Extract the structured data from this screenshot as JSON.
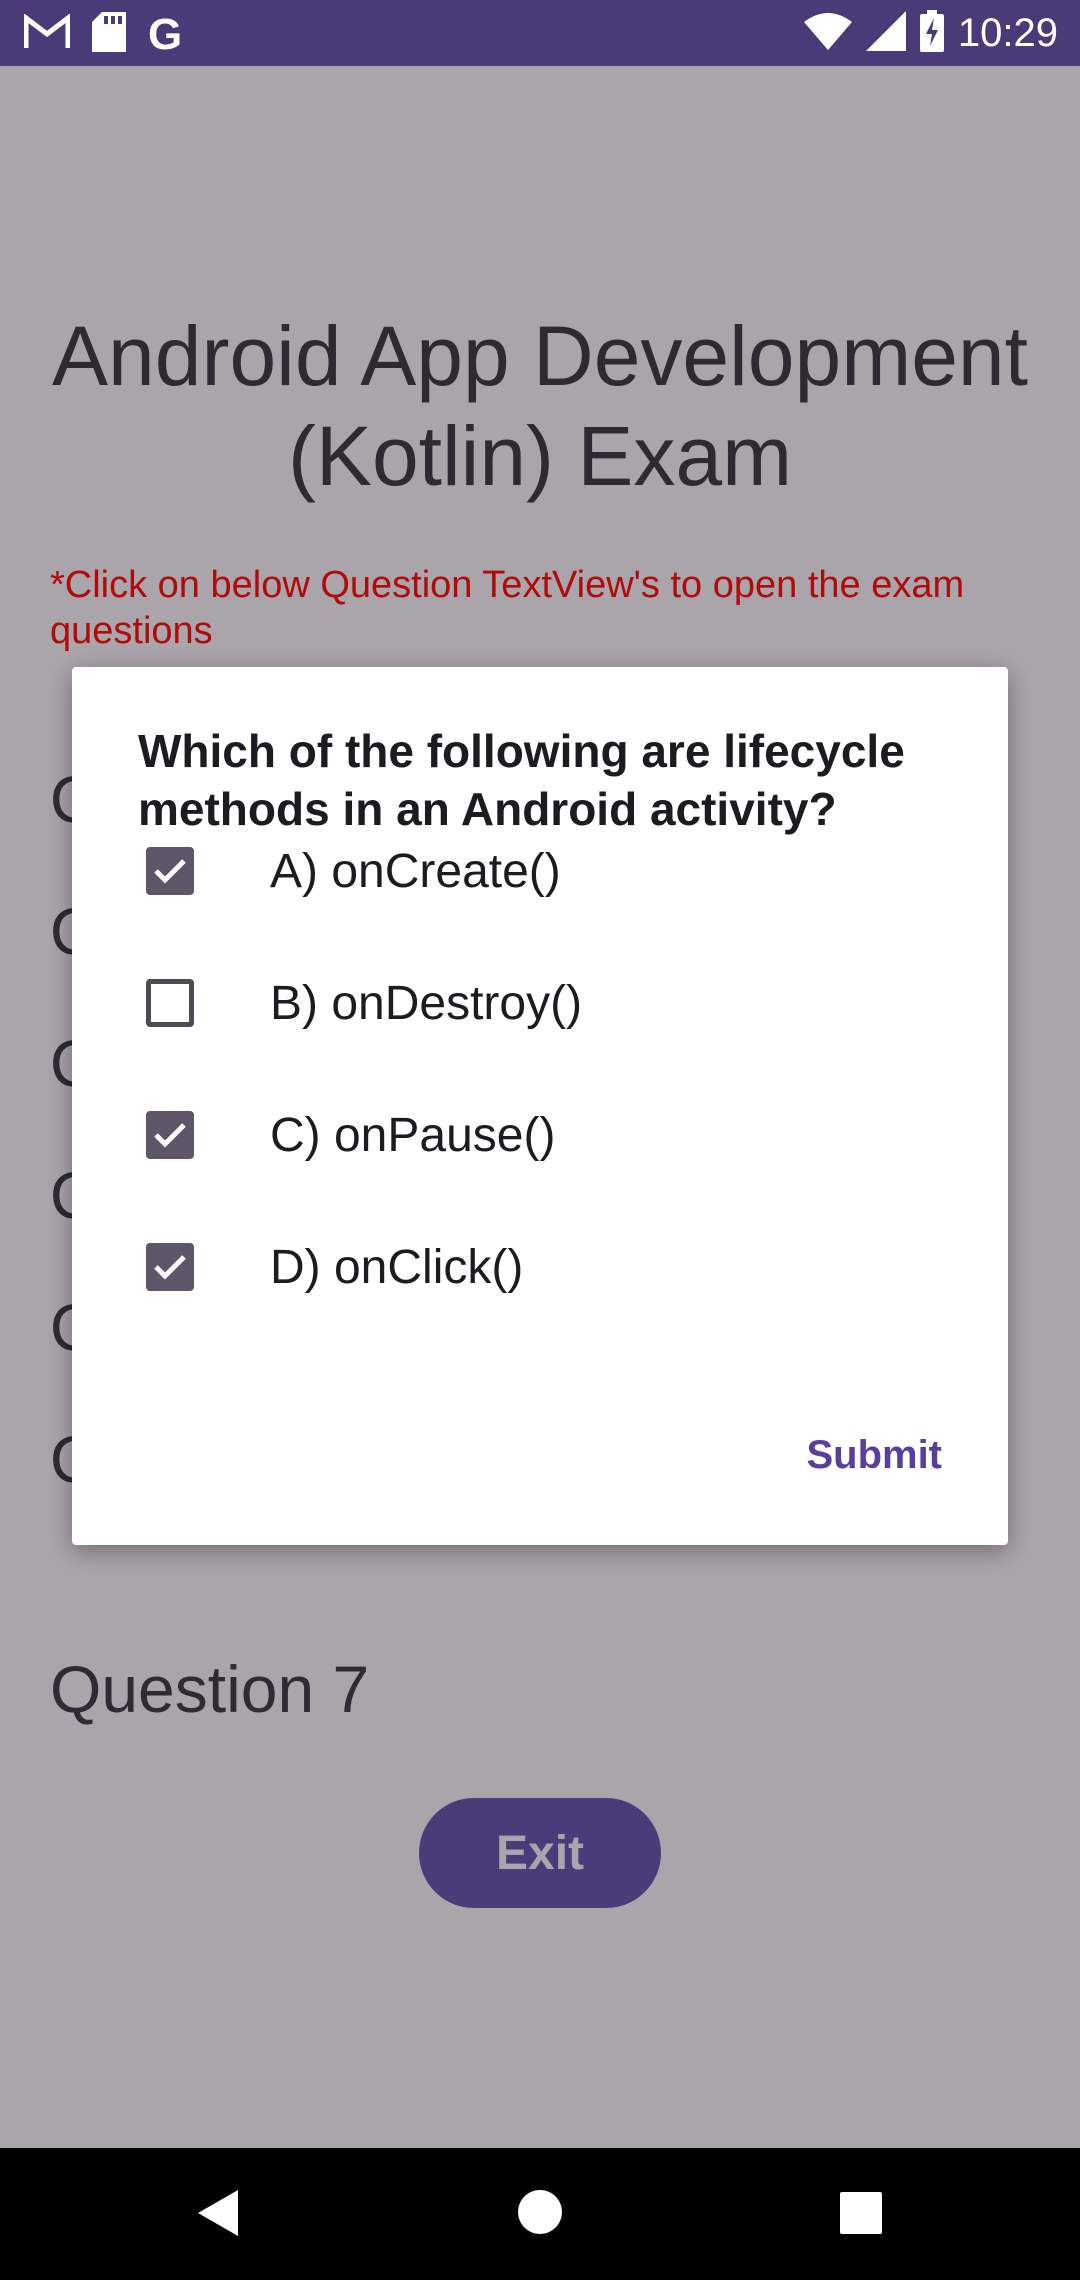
{
  "status_bar": {
    "time": "10:29",
    "left_icons": [
      "gmail-icon",
      "sd-card-icon",
      "google-icon"
    ],
    "right_icons": [
      "wifi-icon",
      "signal-icon",
      "battery-charging-icon"
    ]
  },
  "app": {
    "title_line1": "Android App Development",
    "title_line2": "(Kotlin) Exam",
    "hint": "*Click on below Question TextView's to open the exam questions",
    "questions": [
      "Q",
      "Q",
      "Q",
      "Q",
      "Q",
      "Q",
      "Question 7"
    ],
    "exit_label": "Exit"
  },
  "dialog": {
    "title": "Which of the following are lifecycle methods in an Android activity?",
    "options": [
      {
        "label": "A) onCreate()",
        "checked": true
      },
      {
        "label": "B) onDestroy()",
        "checked": false
      },
      {
        "label": "C) onPause()",
        "checked": true
      },
      {
        "label": "D) onClick()",
        "checked": true
      }
    ],
    "submit_label": "Submit"
  },
  "nav": {
    "icons": [
      "back-icon",
      "home-icon",
      "recents-icon"
    ]
  },
  "colors": {
    "status_bar": "#4a3a78",
    "scrim_background": "#aaa5ab",
    "hint_red": "#b10a0a",
    "accent": "#5a3e9e",
    "checkbox": "#5c5668"
  }
}
